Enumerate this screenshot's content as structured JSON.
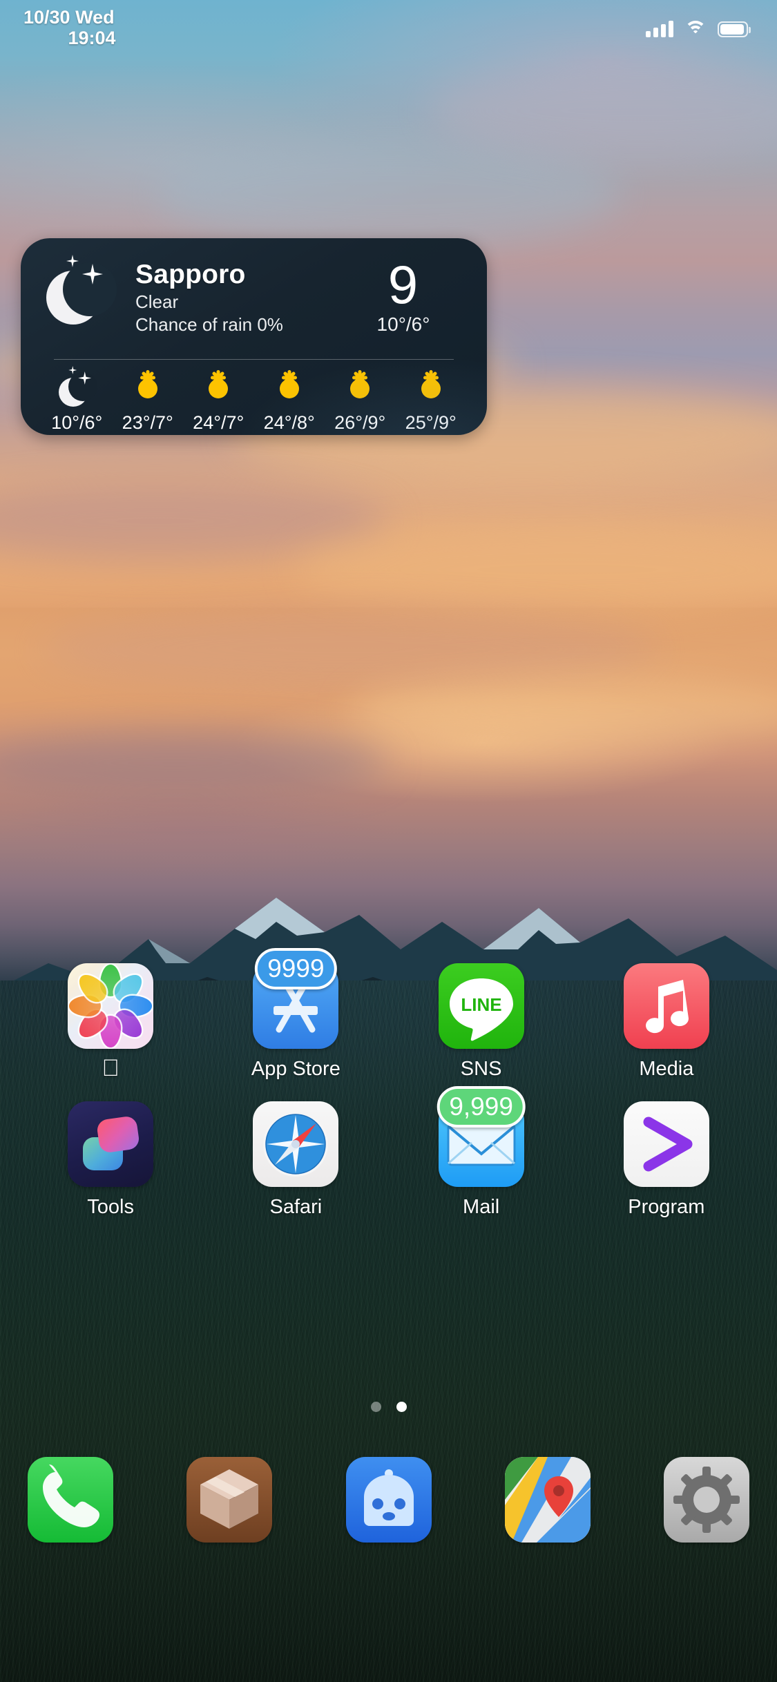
{
  "statusbar": {
    "date": "10/30 Wed",
    "time": "19:04",
    "signal_icon": "cellular-bars-icon",
    "wifi_icon": "wifi-icon",
    "battery_icon": "battery-icon"
  },
  "widget": {
    "name": "weather-widget",
    "city": "Sapporo",
    "condition": "Clear",
    "rain_chance": "Chance of rain 0%",
    "current_temp": "9",
    "hi_lo": "10°/6°",
    "current_icon": "moon-stars-icon",
    "forecast": [
      {
        "icon": "moon-stars-icon",
        "temps": "10°/6°"
      },
      {
        "icon": "sun-icon",
        "temps": "23°/7°"
      },
      {
        "icon": "sun-icon",
        "temps": "24°/7°"
      },
      {
        "icon": "sun-icon",
        "temps": "24°/8°"
      },
      {
        "icon": "sun-icon",
        "temps": "26°/9°"
      },
      {
        "icon": "sun-icon",
        "temps": "25°/9°"
      }
    ]
  },
  "home": {
    "row1": [
      {
        "label": "",
        "icon": "photos-icon",
        "badge": ""
      },
      {
        "label": "App Store",
        "icon": "app-store-icon",
        "badge": "9999"
      },
      {
        "label": "SNS",
        "icon": "line-icon",
        "badge": ""
      },
      {
        "label": "Media",
        "icon": "music-note-icon",
        "badge": ""
      }
    ],
    "row2": [
      {
        "label": "Tools",
        "icon": "shortcuts-icon",
        "badge": ""
      },
      {
        "label": "Safari",
        "icon": "safari-compass-icon",
        "badge": ""
      },
      {
        "label": "Mail",
        "icon": "mail-envelope-icon",
        "badge": "9,999"
      },
      {
        "label": "Program",
        "icon": "chevron-right-icon",
        "badge": ""
      }
    ],
    "page_dots": {
      "count": 2,
      "active": 1
    }
  },
  "dock": [
    {
      "name": "phone",
      "icon": "phone-handset-icon"
    },
    {
      "name": "cydia",
      "icon": "cydia-box-icon"
    },
    {
      "name": "bot",
      "icon": "robot-icon"
    },
    {
      "name": "maps",
      "icon": "google-maps-icon"
    },
    {
      "name": "settings",
      "icon": "gear-icon"
    }
  ],
  "colors": {
    "badge_blue": "#3b9ae8",
    "badge_green": "#5ed67a",
    "widget_bg": "#17242f",
    "sun_yellow": "#fdc300"
  }
}
